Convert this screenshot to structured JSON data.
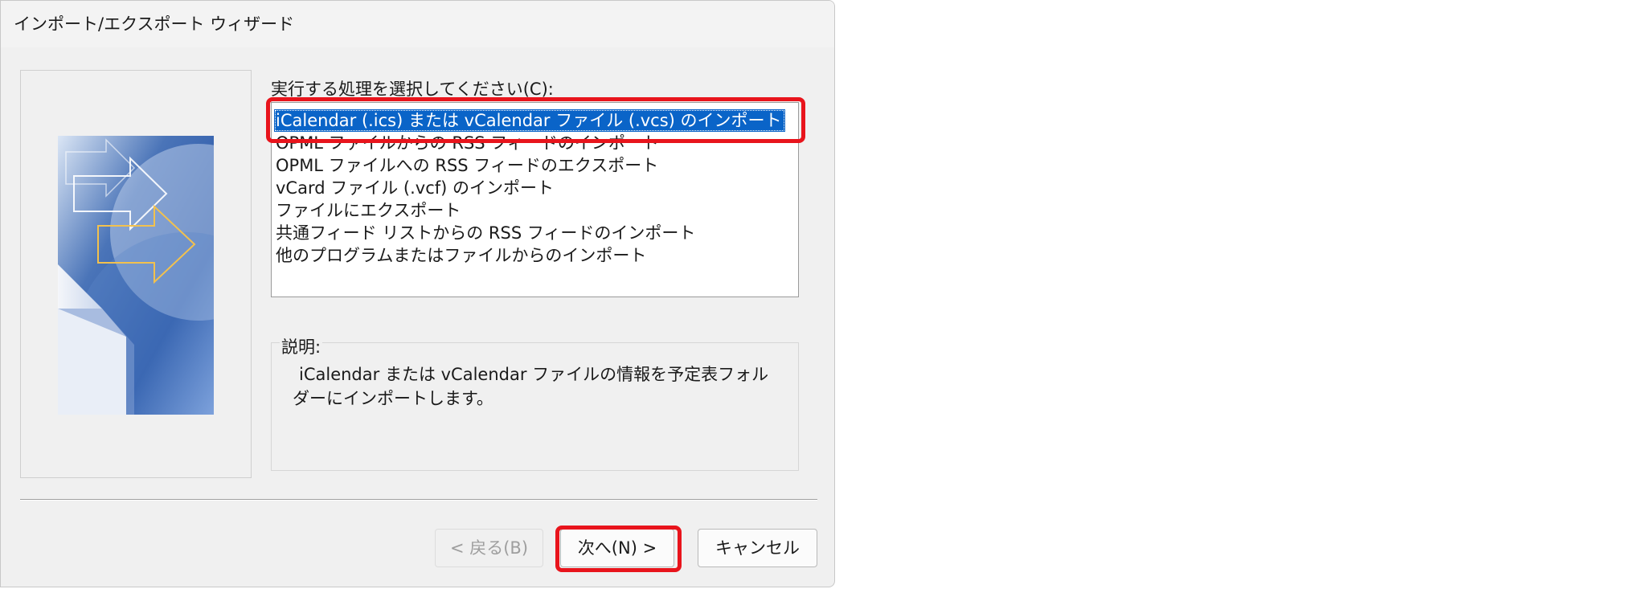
{
  "window": {
    "title": "インポート/エクスポート ウィザード"
  },
  "prompt_label": "実行する処理を選択してください(C):",
  "actions": [
    {
      "label": "iCalendar (.ics) または vCalendar ファイル (.vcs) のインポート",
      "selected": true
    },
    {
      "label": "OPML ファイルからの RSS フィードのインポート",
      "selected": false
    },
    {
      "label": "OPML ファイルへの RSS フィードのエクスポート",
      "selected": false
    },
    {
      "label": "vCard ファイル (.vcf) のインポート",
      "selected": false
    },
    {
      "label": "ファイルにエクスポート",
      "selected": false
    },
    {
      "label": "共通フィード リストからの RSS フィードのインポート",
      "selected": false
    },
    {
      "label": "他のプログラムまたはファイルからのインポート",
      "selected": false
    }
  ],
  "description": {
    "label": "説明:",
    "text": "iCalendar または vCalendar ファイルの情報を予定表フォルダーにインポートします。"
  },
  "buttons": {
    "back": {
      "label": "< 戻る(B)",
      "enabled": false
    },
    "next": {
      "label": "次へ(N) >",
      "enabled": true
    },
    "cancel": {
      "label": "キャンセル",
      "enabled": true
    }
  },
  "colors": {
    "selection": "#0a64c8",
    "highlight": "#e8141c",
    "dialog_background": "#f0f0f0"
  }
}
